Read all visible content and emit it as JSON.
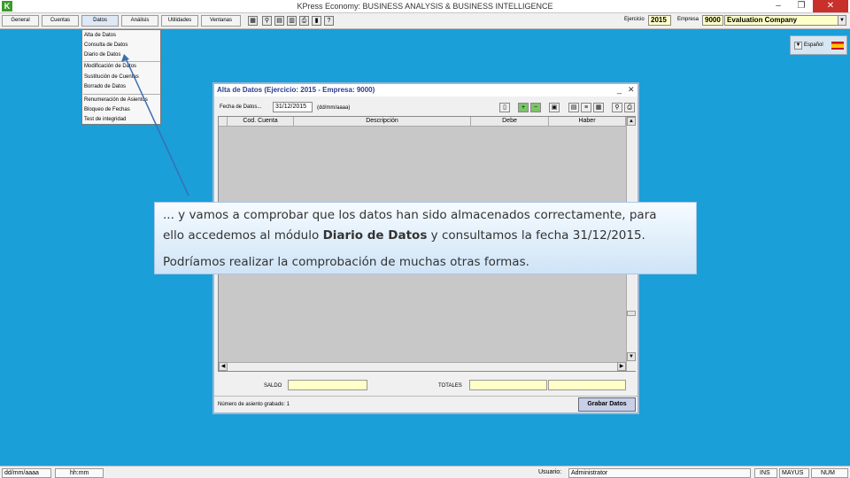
{
  "app": {
    "title": "KPress Economy: BUSINESS ANALYSIS & BUSINESS INTELLIGENCE",
    "minimize": "–",
    "restore": "❐",
    "close": "✕"
  },
  "menu": [
    "General",
    "Cuentas",
    "Datos",
    "Análisis",
    "Utilidades",
    "Ventanas"
  ],
  "header": {
    "ejercicio_label": "Ejercicio",
    "ejercicio_value": "2015",
    "empresa_label": "Empresa",
    "empresa_code": "9000",
    "empresa_name": "Evaluation Company"
  },
  "language": {
    "selected": "Español"
  },
  "datos_menu": {
    "items": [
      "Alta de Datos",
      "Consulta de Datos",
      "Diario de Datos",
      "Modificación de Datos",
      "Sustitución de Cuentas",
      "Borrado de Datos",
      "Renumeración de Asientos",
      "Bloqueo de Fechas",
      "Test de integridad"
    ]
  },
  "window": {
    "title": "Alta de Datos (Ejercicio: 2015 - Empresa: 9000)",
    "minimize": "_",
    "close": "✕",
    "fecha_label": "Fecha de Datos...",
    "fecha_value": "31/12/2015",
    "fecha_hint": "(dd/mm/aaaa)",
    "columns": [
      "Cod. Cuenta",
      "Descripción",
      "Debe",
      "Haber"
    ],
    "saldo_label": "SALDO",
    "totales_label": "TOTALES",
    "asiento_text": "Número de asiento grabado: 1",
    "grabar_label": "Grabar Datos"
  },
  "callout": {
    "line1": "... y vamos a comprobar que los datos han sido almacenados correctamente, para",
    "line2_start": "ello accedemos al módulo",
    "line2_bold": "Diario de Datos",
    "line2_end": "y consultamos la fecha 31/12/2015.",
    "line3": "Podríamos realizar la comprobación de muchas otras formas."
  },
  "statusbar": {
    "date_format": "dd/mm/aaaa",
    "time_format": "hh:mm",
    "usuario_label": "Usuario:",
    "usuario_value": "Administrator",
    "ins": "INS",
    "mayus": "MAYUS",
    "num": "NUM"
  },
  "colors": {
    "desktop": "#1a9fd9",
    "field_yellow": "#ffffc8",
    "arrow": "#3a6fb0"
  }
}
